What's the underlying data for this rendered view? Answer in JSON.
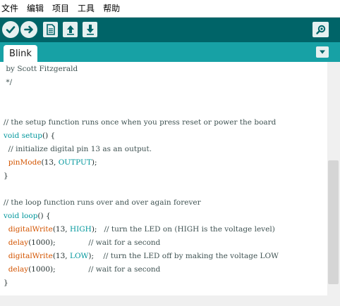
{
  "menu": {
    "items": [
      "文件",
      "编辑",
      "项目",
      "工具",
      "帮助"
    ]
  },
  "toolbar": {
    "buttons": [
      {
        "name": "verify-button",
        "icon": "checkmark-icon"
      },
      {
        "name": "upload-button",
        "icon": "arrow-right-icon"
      },
      {
        "name": "new-button",
        "icon": "document-icon"
      },
      {
        "name": "open-button",
        "icon": "arrow-up-icon"
      },
      {
        "name": "save-button",
        "icon": "arrow-down-icon"
      },
      {
        "name": "serial-monitor-button",
        "icon": "magnifier-icon"
      }
    ]
  },
  "tabs": [
    {
      "label": "Blink"
    }
  ],
  "colors": {
    "toolbar": "#006468",
    "tabstrip": "#17a1a5",
    "keyword": "#00979c",
    "function": "#d35400"
  },
  "code": {
    "lines": [
      {
        "tokens": [
          {
            "t": " by Scott Fitzgerald",
            "c": "cm"
          }
        ]
      },
      {
        "tokens": [
          {
            "t": " */",
            "c": "cm"
          }
        ]
      },
      {
        "tokens": []
      },
      {
        "tokens": []
      },
      {
        "tokens": [
          {
            "t": "// the setup function runs once when you press reset or power the board",
            "c": "cm"
          }
        ]
      },
      {
        "tokens": [
          {
            "t": "void",
            "c": "kw"
          },
          {
            "t": " ",
            "c": ""
          },
          {
            "t": "setup",
            "c": "kw"
          },
          {
            "t": "() {",
            "c": ""
          }
        ]
      },
      {
        "tokens": [
          {
            "t": "  // initialize digital pin 13 as an output.",
            "c": "cm"
          }
        ]
      },
      {
        "tokens": [
          {
            "t": "  ",
            "c": ""
          },
          {
            "t": "pinMode",
            "c": "fn"
          },
          {
            "t": "(13, ",
            "c": ""
          },
          {
            "t": "OUTPUT",
            "c": "const"
          },
          {
            "t": ");",
            "c": ""
          }
        ]
      },
      {
        "tokens": [
          {
            "t": "}",
            "c": ""
          }
        ]
      },
      {
        "tokens": []
      },
      {
        "tokens": [
          {
            "t": "// the loop function runs over and over again forever",
            "c": "cm"
          }
        ]
      },
      {
        "tokens": [
          {
            "t": "void",
            "c": "kw"
          },
          {
            "t": " ",
            "c": ""
          },
          {
            "t": "loop",
            "c": "kw"
          },
          {
            "t": "() {",
            "c": ""
          }
        ]
      },
      {
        "tokens": [
          {
            "t": "  ",
            "c": ""
          },
          {
            "t": "digitalWrite",
            "c": "fn"
          },
          {
            "t": "(13, ",
            "c": ""
          },
          {
            "t": "HIGH",
            "c": "const"
          },
          {
            "t": ");   ",
            "c": ""
          },
          {
            "t": "// turn the LED on (HIGH is the voltage level)",
            "c": "cm"
          }
        ]
      },
      {
        "tokens": [
          {
            "t": "  ",
            "c": ""
          },
          {
            "t": "delay",
            "c": "fn"
          },
          {
            "t": "(1000);              ",
            "c": ""
          },
          {
            "t": "// wait for a second",
            "c": "cm"
          }
        ]
      },
      {
        "tokens": [
          {
            "t": "  ",
            "c": ""
          },
          {
            "t": "digitalWrite",
            "c": "fn"
          },
          {
            "t": "(13, ",
            "c": ""
          },
          {
            "t": "LOW",
            "c": "const"
          },
          {
            "t": ");    ",
            "c": ""
          },
          {
            "t": "// turn the LED off by making the voltage LOW",
            "c": "cm"
          }
        ]
      },
      {
        "tokens": [
          {
            "t": "  ",
            "c": ""
          },
          {
            "t": "delay",
            "c": "fn"
          },
          {
            "t": "(1000);              ",
            "c": ""
          },
          {
            "t": "// wait for a second",
            "c": "cm"
          }
        ]
      },
      {
        "tokens": [
          {
            "t": "}",
            "c": ""
          }
        ]
      }
    ]
  }
}
